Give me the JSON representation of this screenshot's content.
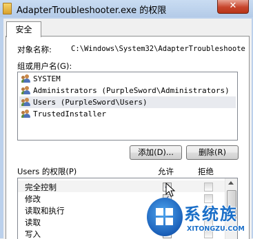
{
  "window": {
    "title": "AdapterTroubleshooter.exe 的权限",
    "close": "✕"
  },
  "tab": {
    "label": "安全"
  },
  "object": {
    "label": "对象名称:",
    "value": "C:\\Windows\\System32\\AdapterTroubleshoote"
  },
  "groups": {
    "label": "组或用户名(G):",
    "items": [
      {
        "name": "SYSTEM"
      },
      {
        "name": "Administrators (PurpleSword\\Administrators)"
      },
      {
        "name": "Users (PurpleSword\\Users)"
      },
      {
        "name": "TrustedInstaller"
      }
    ]
  },
  "buttons": {
    "add": "添加(D)...",
    "remove": "删除(R)"
  },
  "permissions": {
    "label": "Users 的权限(P)",
    "allow_header": "允许",
    "deny_header": "拒绝",
    "rows": [
      {
        "name": "完全控制",
        "allow": true,
        "deny": false
      },
      {
        "name": "修改",
        "allow": true,
        "deny": false
      },
      {
        "name": "读取和执行",
        "allow": true,
        "deny": false
      },
      {
        "name": "读取",
        "allow": true,
        "deny": false
      },
      {
        "name": "写入",
        "allow": true,
        "deny": false
      }
    ]
  },
  "watermark": {
    "brand": "系统族",
    "url": "XITONGZU.COM"
  },
  "colors": {
    "titlebar": "#bcd1ec",
    "close": "#c7452c",
    "watermark": "#1b6fc8"
  }
}
